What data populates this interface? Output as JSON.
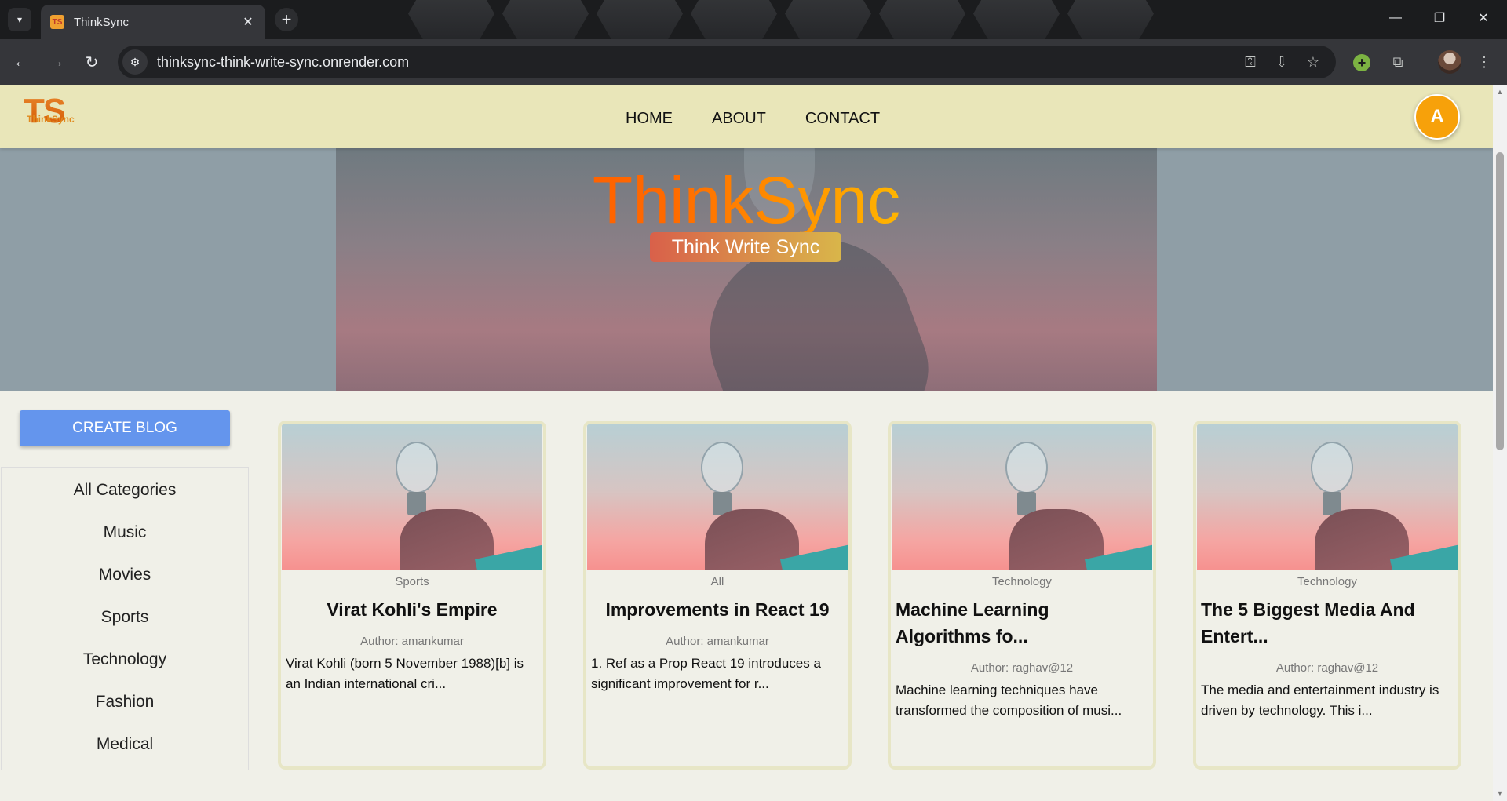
{
  "browser": {
    "tab_title": "ThinkSync",
    "url": "thinksync-think-write-sync.onrender.com"
  },
  "header": {
    "logo_text": "TS",
    "logo_subtext": "ThinkSync",
    "nav": [
      "HOME",
      "ABOUT",
      "CONTACT"
    ],
    "avatar_letter": "A"
  },
  "hero": {
    "title": "ThinkSync",
    "tagline": "Think Write Sync"
  },
  "sidebar": {
    "create_button": "CREATE BLOG",
    "categories": [
      "All Categories",
      "Music",
      "Movies",
      "Sports",
      "Technology",
      "Fashion",
      "Medical"
    ]
  },
  "posts": [
    {
      "category": "Sports",
      "title": "Virat Kohli's Empire",
      "author": "Author: amankumar",
      "excerpt": "Virat Kohli (born 5 November 1988)[b] is an Indian international cri..."
    },
    {
      "category": "All",
      "title": "Improvements in React 19",
      "author": "Author: amankumar",
      "excerpt": "1. Ref as a Prop React 19 introduces a significant improvement for r..."
    },
    {
      "category": "Technology",
      "title": "Machine Learning Algorithms fo...",
      "author": "Author: raghav@12",
      "excerpt": "Machine learning techniques have transformed the composition of musi..."
    },
    {
      "category": "Technology",
      "title": "The 5 Biggest Media And Entert...",
      "author": "Author: raghav@12",
      "excerpt": "The media and entertainment industry is driven by technology. This i..."
    }
  ]
}
